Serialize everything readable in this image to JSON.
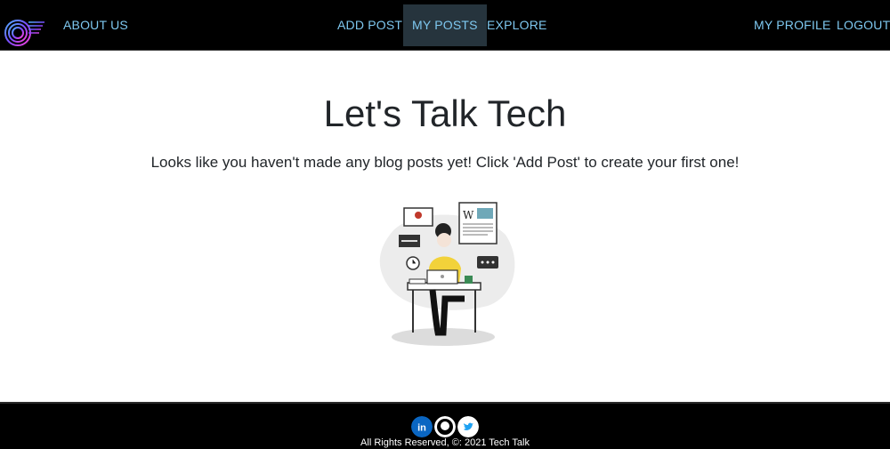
{
  "nav": {
    "logo_icon": "brand-logo-icon",
    "about": "ABOUT US",
    "add_post": "ADD POST",
    "my_posts": "MY POSTS",
    "explore": "EXPLORE",
    "my_profile": "MY PROFILE",
    "logout": "LOGOUT",
    "active_tab": "MY POSTS"
  },
  "main": {
    "title": "Let's Talk Tech",
    "empty_message": "Looks like you haven't made any blog posts yet! Click 'Add Post' to create your first one!",
    "illustration": "person-working-on-laptop-illustration"
  },
  "footer": {
    "social": [
      "linkedin-icon",
      "github-icon",
      "twitter-icon"
    ],
    "copyright": "All Rights Reserved, ©: 2021 Tech Talk"
  },
  "colors": {
    "nav_bg": "#000000",
    "nav_link": "#7ec8f0",
    "active_bg": "#26343d",
    "text": "#212529",
    "footer_bg": "#000000"
  }
}
